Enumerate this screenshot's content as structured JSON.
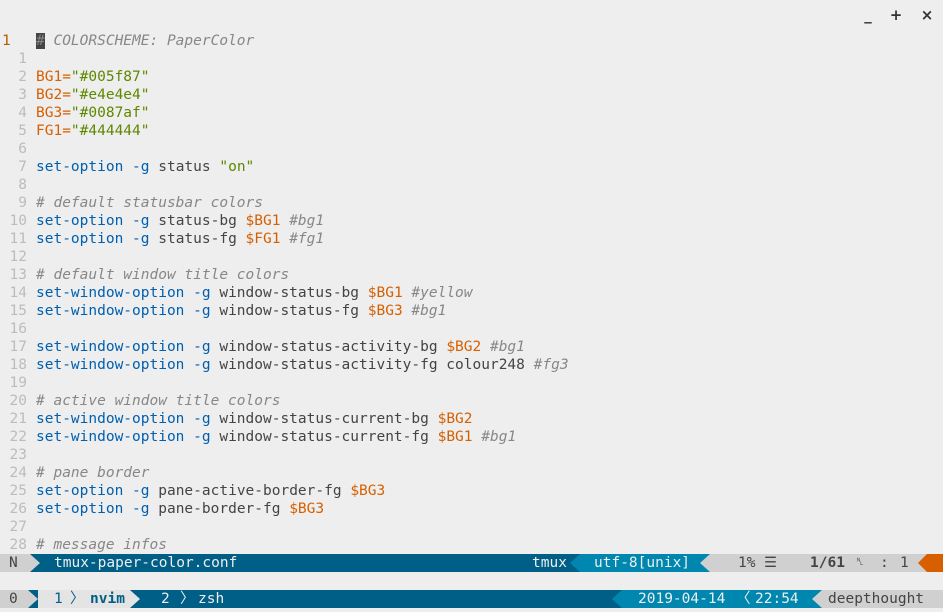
{
  "window": {
    "minimize_label": "_",
    "maximize_label": "+",
    "close_label": "×"
  },
  "editor": {
    "cursor_char": "#",
    "lines": [
      {
        "num": "1",
        "tokens": [
          {
            "t": " COLORSCHEME: PaperColor",
            "c": "comment"
          }
        ]
      },
      {
        "num": "1",
        "tokens": []
      },
      {
        "num": "2",
        "tokens": [
          {
            "t": "BG1=",
            "c": "var"
          },
          {
            "t": "\"#005f87\"",
            "c": "str"
          }
        ]
      },
      {
        "num": "3",
        "tokens": [
          {
            "t": "BG2=",
            "c": "var"
          },
          {
            "t": "\"#e4e4e4\"",
            "c": "str"
          }
        ]
      },
      {
        "num": "4",
        "tokens": [
          {
            "t": "BG3=",
            "c": "var"
          },
          {
            "t": "\"#0087af\"",
            "c": "str"
          }
        ]
      },
      {
        "num": "5",
        "tokens": [
          {
            "t": "FG1=",
            "c": "var"
          },
          {
            "t": "\"#444444\"",
            "c": "str"
          }
        ]
      },
      {
        "num": "6",
        "tokens": []
      },
      {
        "num": "7",
        "tokens": [
          {
            "t": "set-option",
            "c": "kw"
          },
          {
            "t": " ",
            "c": "norm"
          },
          {
            "t": "-g",
            "c": "kw"
          },
          {
            "t": " status ",
            "c": "norm"
          },
          {
            "t": "\"on\"",
            "c": "str"
          }
        ]
      },
      {
        "num": "8",
        "tokens": []
      },
      {
        "num": "9",
        "tokens": [
          {
            "t": "# default statusbar colors",
            "c": "comment"
          }
        ]
      },
      {
        "num": "10",
        "tokens": [
          {
            "t": "set-option",
            "c": "kw"
          },
          {
            "t": " ",
            "c": "norm"
          },
          {
            "t": "-g",
            "c": "kw"
          },
          {
            "t": " status-bg ",
            "c": "norm"
          },
          {
            "t": "$BG1",
            "c": "var"
          },
          {
            "t": " ",
            "c": "norm"
          },
          {
            "t": "#bg1",
            "c": "comment"
          }
        ]
      },
      {
        "num": "11",
        "tokens": [
          {
            "t": "set-option",
            "c": "kw"
          },
          {
            "t": " ",
            "c": "norm"
          },
          {
            "t": "-g",
            "c": "kw"
          },
          {
            "t": " status-fg ",
            "c": "norm"
          },
          {
            "t": "$FG1",
            "c": "var"
          },
          {
            "t": " ",
            "c": "norm"
          },
          {
            "t": "#fg1",
            "c": "comment"
          }
        ]
      },
      {
        "num": "12",
        "tokens": []
      },
      {
        "num": "13",
        "tokens": [
          {
            "t": "# default window title colors",
            "c": "comment"
          }
        ]
      },
      {
        "num": "14",
        "tokens": [
          {
            "t": "set-window-option",
            "c": "kw"
          },
          {
            "t": " ",
            "c": "norm"
          },
          {
            "t": "-g",
            "c": "kw"
          },
          {
            "t": " window-status-bg ",
            "c": "norm"
          },
          {
            "t": "$BG1",
            "c": "var"
          },
          {
            "t": " ",
            "c": "norm"
          },
          {
            "t": "#yellow",
            "c": "comment"
          }
        ]
      },
      {
        "num": "15",
        "tokens": [
          {
            "t": "set-window-option",
            "c": "kw"
          },
          {
            "t": " ",
            "c": "norm"
          },
          {
            "t": "-g",
            "c": "kw"
          },
          {
            "t": " window-status-fg ",
            "c": "norm"
          },
          {
            "t": "$BG3",
            "c": "var"
          },
          {
            "t": " ",
            "c": "norm"
          },
          {
            "t": "#bg1",
            "c": "comment"
          }
        ]
      },
      {
        "num": "16",
        "tokens": []
      },
      {
        "num": "17",
        "tokens": [
          {
            "t": "set-window-option",
            "c": "kw"
          },
          {
            "t": " ",
            "c": "norm"
          },
          {
            "t": "-g",
            "c": "kw"
          },
          {
            "t": " window-status-activity-bg ",
            "c": "norm"
          },
          {
            "t": "$BG2",
            "c": "var"
          },
          {
            "t": " ",
            "c": "norm"
          },
          {
            "t": "#bg1",
            "c": "comment"
          }
        ]
      },
      {
        "num": "18",
        "tokens": [
          {
            "t": "set-window-option",
            "c": "kw"
          },
          {
            "t": " ",
            "c": "norm"
          },
          {
            "t": "-g",
            "c": "kw"
          },
          {
            "t": " window-status-activity-fg colour248 ",
            "c": "norm"
          },
          {
            "t": "#fg3",
            "c": "comment"
          }
        ]
      },
      {
        "num": "19",
        "tokens": []
      },
      {
        "num": "20",
        "tokens": [
          {
            "t": "# active window title colors",
            "c": "comment"
          }
        ]
      },
      {
        "num": "21",
        "tokens": [
          {
            "t": "set-window-option",
            "c": "kw"
          },
          {
            "t": " ",
            "c": "norm"
          },
          {
            "t": "-g",
            "c": "kw"
          },
          {
            "t": " window-status-current-bg ",
            "c": "norm"
          },
          {
            "t": "$BG2",
            "c": "var"
          }
        ]
      },
      {
        "num": "22",
        "tokens": [
          {
            "t": "set-window-option",
            "c": "kw"
          },
          {
            "t": " ",
            "c": "norm"
          },
          {
            "t": "-g",
            "c": "kw"
          },
          {
            "t": " window-status-current-fg ",
            "c": "norm"
          },
          {
            "t": "$BG1",
            "c": "var"
          },
          {
            "t": " ",
            "c": "norm"
          },
          {
            "t": "#bg1",
            "c": "comment"
          }
        ]
      },
      {
        "num": "23",
        "tokens": []
      },
      {
        "num": "24",
        "tokens": [
          {
            "t": "# pane border",
            "c": "comment"
          }
        ]
      },
      {
        "num": "25",
        "tokens": [
          {
            "t": "set-option",
            "c": "kw"
          },
          {
            "t": " ",
            "c": "norm"
          },
          {
            "t": "-g",
            "c": "kw"
          },
          {
            "t": " pane-active-border-fg ",
            "c": "norm"
          },
          {
            "t": "$BG3",
            "c": "var"
          }
        ]
      },
      {
        "num": "26",
        "tokens": [
          {
            "t": "set-option",
            "c": "kw"
          },
          {
            "t": " ",
            "c": "norm"
          },
          {
            "t": "-g",
            "c": "kw"
          },
          {
            "t": " pane-border-fg ",
            "c": "norm"
          },
          {
            "t": "$BG3",
            "c": "var"
          }
        ]
      },
      {
        "num": "27",
        "tokens": []
      },
      {
        "num": "28",
        "tokens": [
          {
            "t": "# message infos",
            "c": "comment"
          }
        ]
      }
    ]
  },
  "statusline": {
    "mode": "N",
    "filename": "tmux-paper-color.conf",
    "filetype": "tmux",
    "encoding": "utf-8[unix]",
    "percent": "1%",
    "menu_icon": "☰",
    "position": "1/61",
    "line_icon": "␤",
    "col_sep": ":",
    "column": "1"
  },
  "tmux": {
    "session": "0",
    "window1_index": "1",
    "window1_name": "nvim",
    "window2_index": "2",
    "window2_name": "zsh",
    "date": "2019-04-14",
    "time": "22:54",
    "hostname": "deepthought",
    "separator": "〉"
  },
  "colors": {
    "background": "#eeeeee",
    "statusbar": "#005f87",
    "accent": "#0087af",
    "keyword": "#005faf",
    "variable": "#d75f00",
    "string": "#5f8700",
    "comment": "#878787"
  }
}
